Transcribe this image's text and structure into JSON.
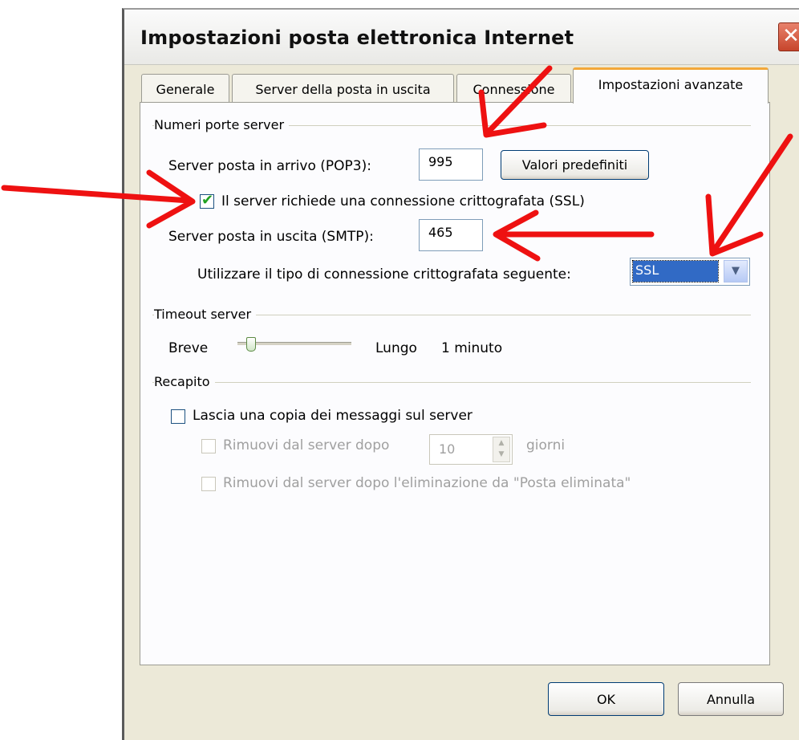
{
  "window": {
    "title": "Impostazioni posta elettronica Internet",
    "close_glyph": "✕"
  },
  "tabs": [
    {
      "label": "Generale"
    },
    {
      "label": "Server della posta in uscita"
    },
    {
      "label": "Connessione"
    },
    {
      "label": "Impostazioni avanzate",
      "active": true
    }
  ],
  "ports": {
    "group_title": "Numeri porte server",
    "incoming_label": "Server posta in arrivo (POP3):",
    "incoming_value": "995",
    "defaults_button": "Valori predefiniti",
    "ssl_checkbox_label": "Il server richiede una connessione crittografata (SSL)",
    "ssl_checked": true,
    "outgoing_label": "Server posta in uscita (SMTP):",
    "outgoing_value": "465",
    "encryption_label": "Utilizzare il tipo di connessione crittografata seguente:",
    "encryption_value": "SSL"
  },
  "timeout": {
    "group_title": "Timeout server",
    "short_label": "Breve",
    "long_label": "Lungo",
    "value_text": "1 minuto",
    "level": 0.1
  },
  "delivery": {
    "group_title": "Recapito",
    "leave_copy_label": "Lascia una copia dei messaggi sul server",
    "leave_copy_checked": false,
    "remove_after_label": "Rimuovi dal server dopo",
    "remove_after_days": "10",
    "days_unit": "giorni",
    "remove_on_delete_label": "Rimuovi dal server dopo l'eliminazione da \"Posta eliminata\""
  },
  "footer": {
    "ok": "OK",
    "cancel": "Annulla"
  },
  "colors": {
    "annotation": "#ee1111",
    "tab_highlight": "#f3a83a",
    "selection": "#316ac5"
  }
}
